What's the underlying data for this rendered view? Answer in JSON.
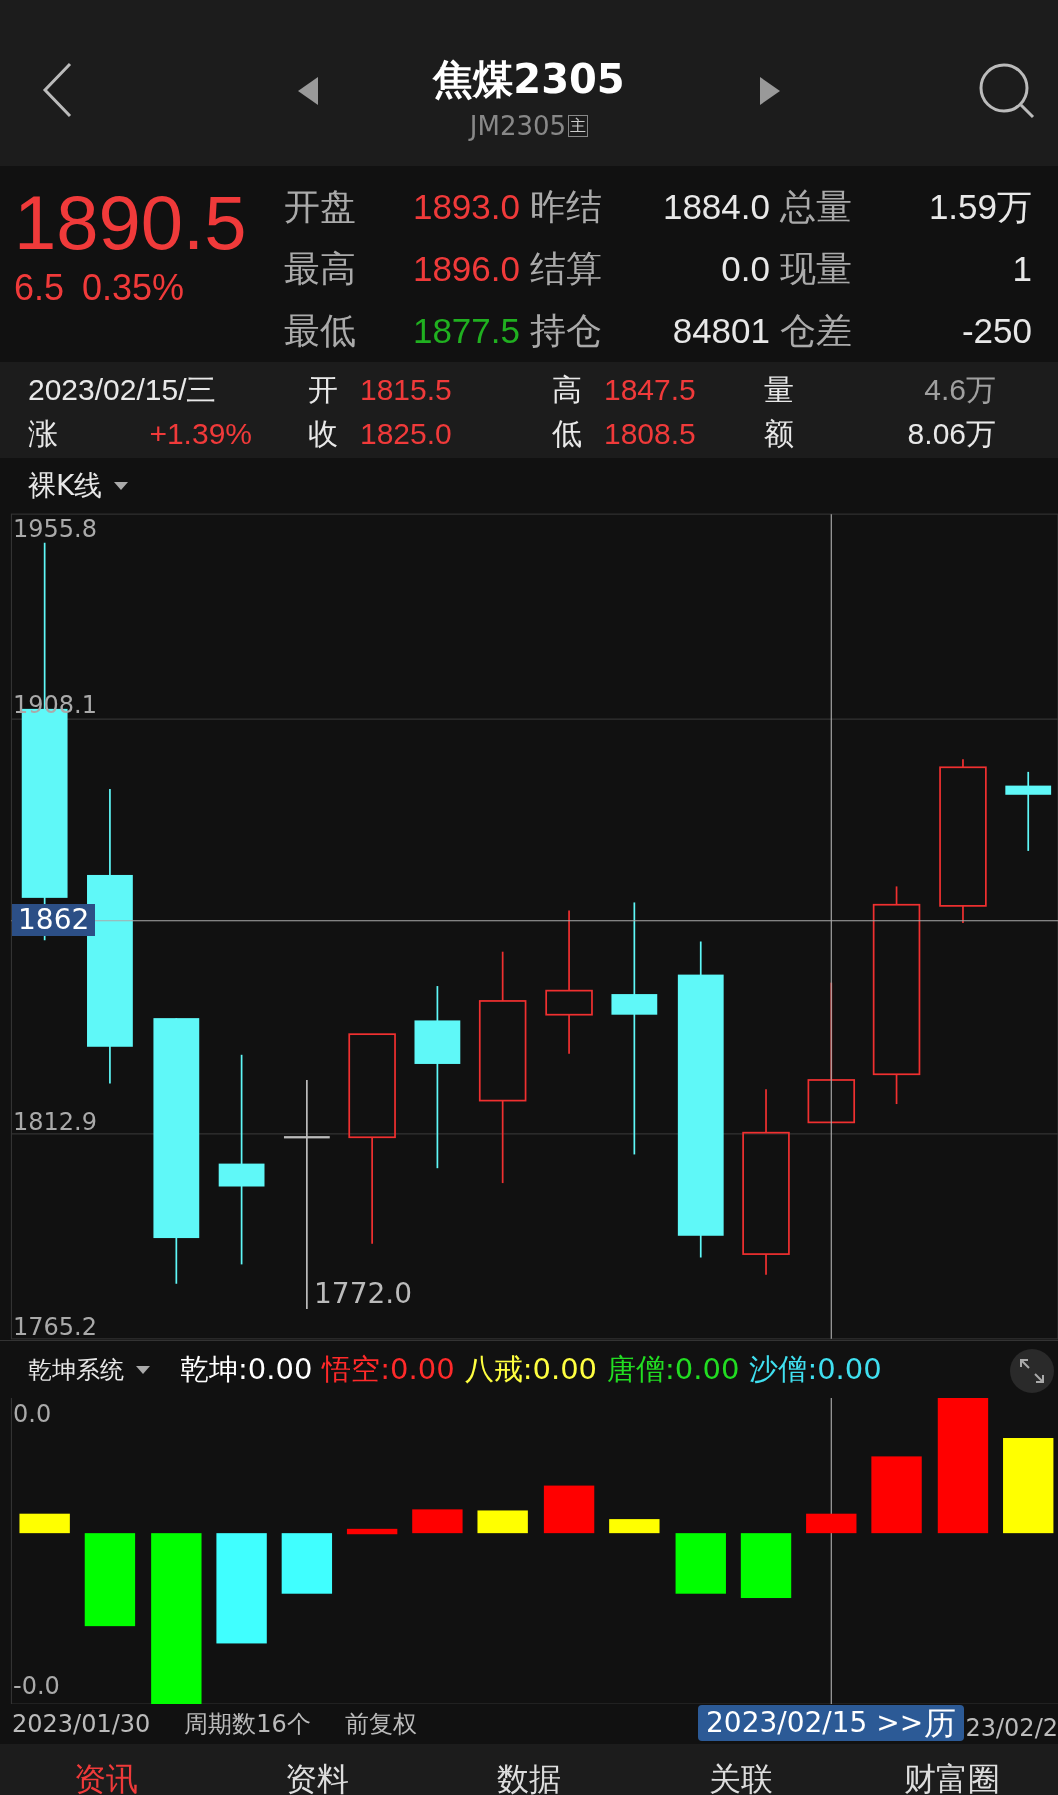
{
  "header": {
    "title": "焦煤2305",
    "code": "JM2305",
    "code_badge": "主"
  },
  "quote": {
    "price": "1890.5",
    "change": "6.5",
    "change_pct": "0.35%",
    "color": "#f03a3a",
    "rows": [
      [
        {
          "label": "开盘",
          "value": "1893.0",
          "color": "#f03a3a"
        },
        {
          "label": "昨结",
          "value": "1884.0",
          "color": "#e8e8e8"
        },
        {
          "label": "总量",
          "value": "1.59万",
          "color": "#e8e8e8"
        }
      ],
      [
        {
          "label": "最高",
          "value": "1896.0",
          "color": "#f03a3a"
        },
        {
          "label": "结算",
          "value": "0.0",
          "color": "#e8e8e8"
        },
        {
          "label": "现量",
          "value": "1",
          "color": "#e8e8e8"
        }
      ],
      [
        {
          "label": "最低",
          "value": "1877.5",
          "color": "#20b020"
        },
        {
          "label": "持仓",
          "value": "84801",
          "color": "#e8e8e8"
        },
        {
          "label": "仓差",
          "value": "-250",
          "color": "#e8e8e8"
        }
      ]
    ]
  },
  "day": {
    "date": "2023/02/15/三",
    "change": {
      "label": "涨",
      "value": "+1.39%",
      "color": "#f03a3a"
    },
    "pairs": [
      {
        "label": "开",
        "value": "1815.5",
        "color": "#f03a3a"
      },
      {
        "label": "高",
        "value": "1847.5",
        "color": "#f03a3a"
      },
      {
        "label": "量",
        "value": "4.6万",
        "color": "#a0a0a0"
      },
      {
        "label": "收",
        "value": "1825.0",
        "color": "#f03a3a"
      },
      {
        "label": "低",
        "value": "1808.5",
        "color": "#f03a3a"
      },
      {
        "label": "额",
        "value": "8.06万",
        "color": "#e8e8e8"
      }
    ]
  },
  "kline": {
    "selector": "裸K线",
    "price_labels": [
      "1955.8",
      "1908.1",
      "1812.9",
      "1765.2"
    ],
    "crosshair_label": "1862",
    "low_label": "1772.0"
  },
  "indicator": {
    "selector": "乾坤系统",
    "values": [
      {
        "name": "乾坤:",
        "value": "0.00",
        "color": "#ffffff"
      },
      {
        "name": "悟空:",
        "value": "0.00",
        "color": "#ff2a2a"
      },
      {
        "name": "八戒:",
        "value": "0.00",
        "color": "#ffff40"
      },
      {
        "name": "唐僧:",
        "value": "0.00",
        "color": "#22dd22"
      },
      {
        "name": "沙僧:",
        "value": "0.00",
        "color": "#40e0f0"
      }
    ],
    "top_label": "0.0",
    "bottom_label": "-0.0"
  },
  "footer": {
    "start_date": "2023/01/30",
    "periods": "周期数16个",
    "adjust": "前复权",
    "cursor_date": "2023/02/15 >>",
    "cursor_tag": "历",
    "end_date": "23/02/2"
  },
  "tabs": [
    {
      "label": "资讯",
      "selected": true
    },
    {
      "label": "资料",
      "selected": false
    },
    {
      "label": "数据",
      "selected": false
    },
    {
      "label": "关联",
      "selected": false
    },
    {
      "label": "财富圈",
      "selected": false
    }
  ]
}
